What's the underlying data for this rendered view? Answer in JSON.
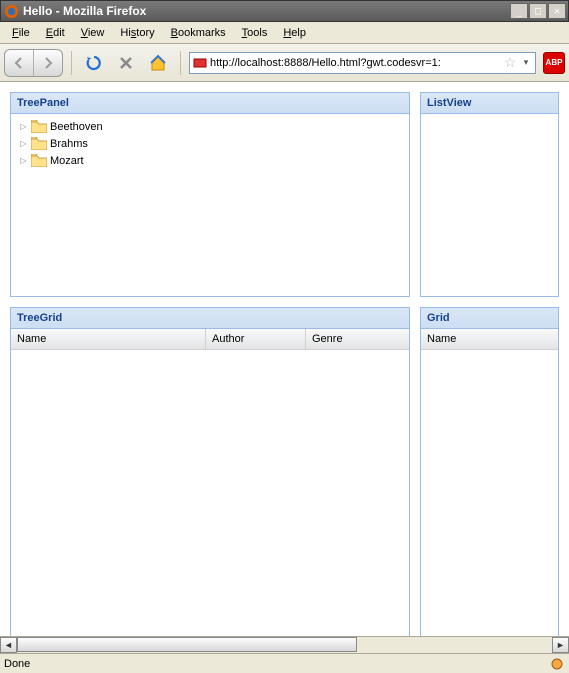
{
  "window": {
    "title": "Hello - Mozilla Firefox"
  },
  "menubar": {
    "items": [
      {
        "label": "File",
        "accel": "F"
      },
      {
        "label": "Edit",
        "accel": "E"
      },
      {
        "label": "View",
        "accel": "V"
      },
      {
        "label": "History",
        "accel": "s"
      },
      {
        "label": "Bookmarks",
        "accel": "B"
      },
      {
        "label": "Tools",
        "accel": "T"
      },
      {
        "label": "Help",
        "accel": "H"
      }
    ]
  },
  "toolbar": {
    "url": "http://localhost:8888/Hello.html?gwt.codesvr=1:"
  },
  "panels": {
    "treepanel": {
      "title": "TreePanel",
      "items": [
        {
          "label": "Beethoven"
        },
        {
          "label": "Brahms"
        },
        {
          "label": "Mozart"
        }
      ]
    },
    "listview": {
      "title": "ListView"
    },
    "treegrid": {
      "title": "TreeGrid",
      "columns": [
        {
          "label": "Name",
          "width": 195
        },
        {
          "label": "Author",
          "width": 100
        },
        {
          "label": "Genre",
          "width": 100
        }
      ]
    },
    "grid": {
      "title": "Grid",
      "columns": [
        {
          "label": "Name",
          "width": 130
        }
      ]
    }
  },
  "statusbar": {
    "text": "Done"
  }
}
